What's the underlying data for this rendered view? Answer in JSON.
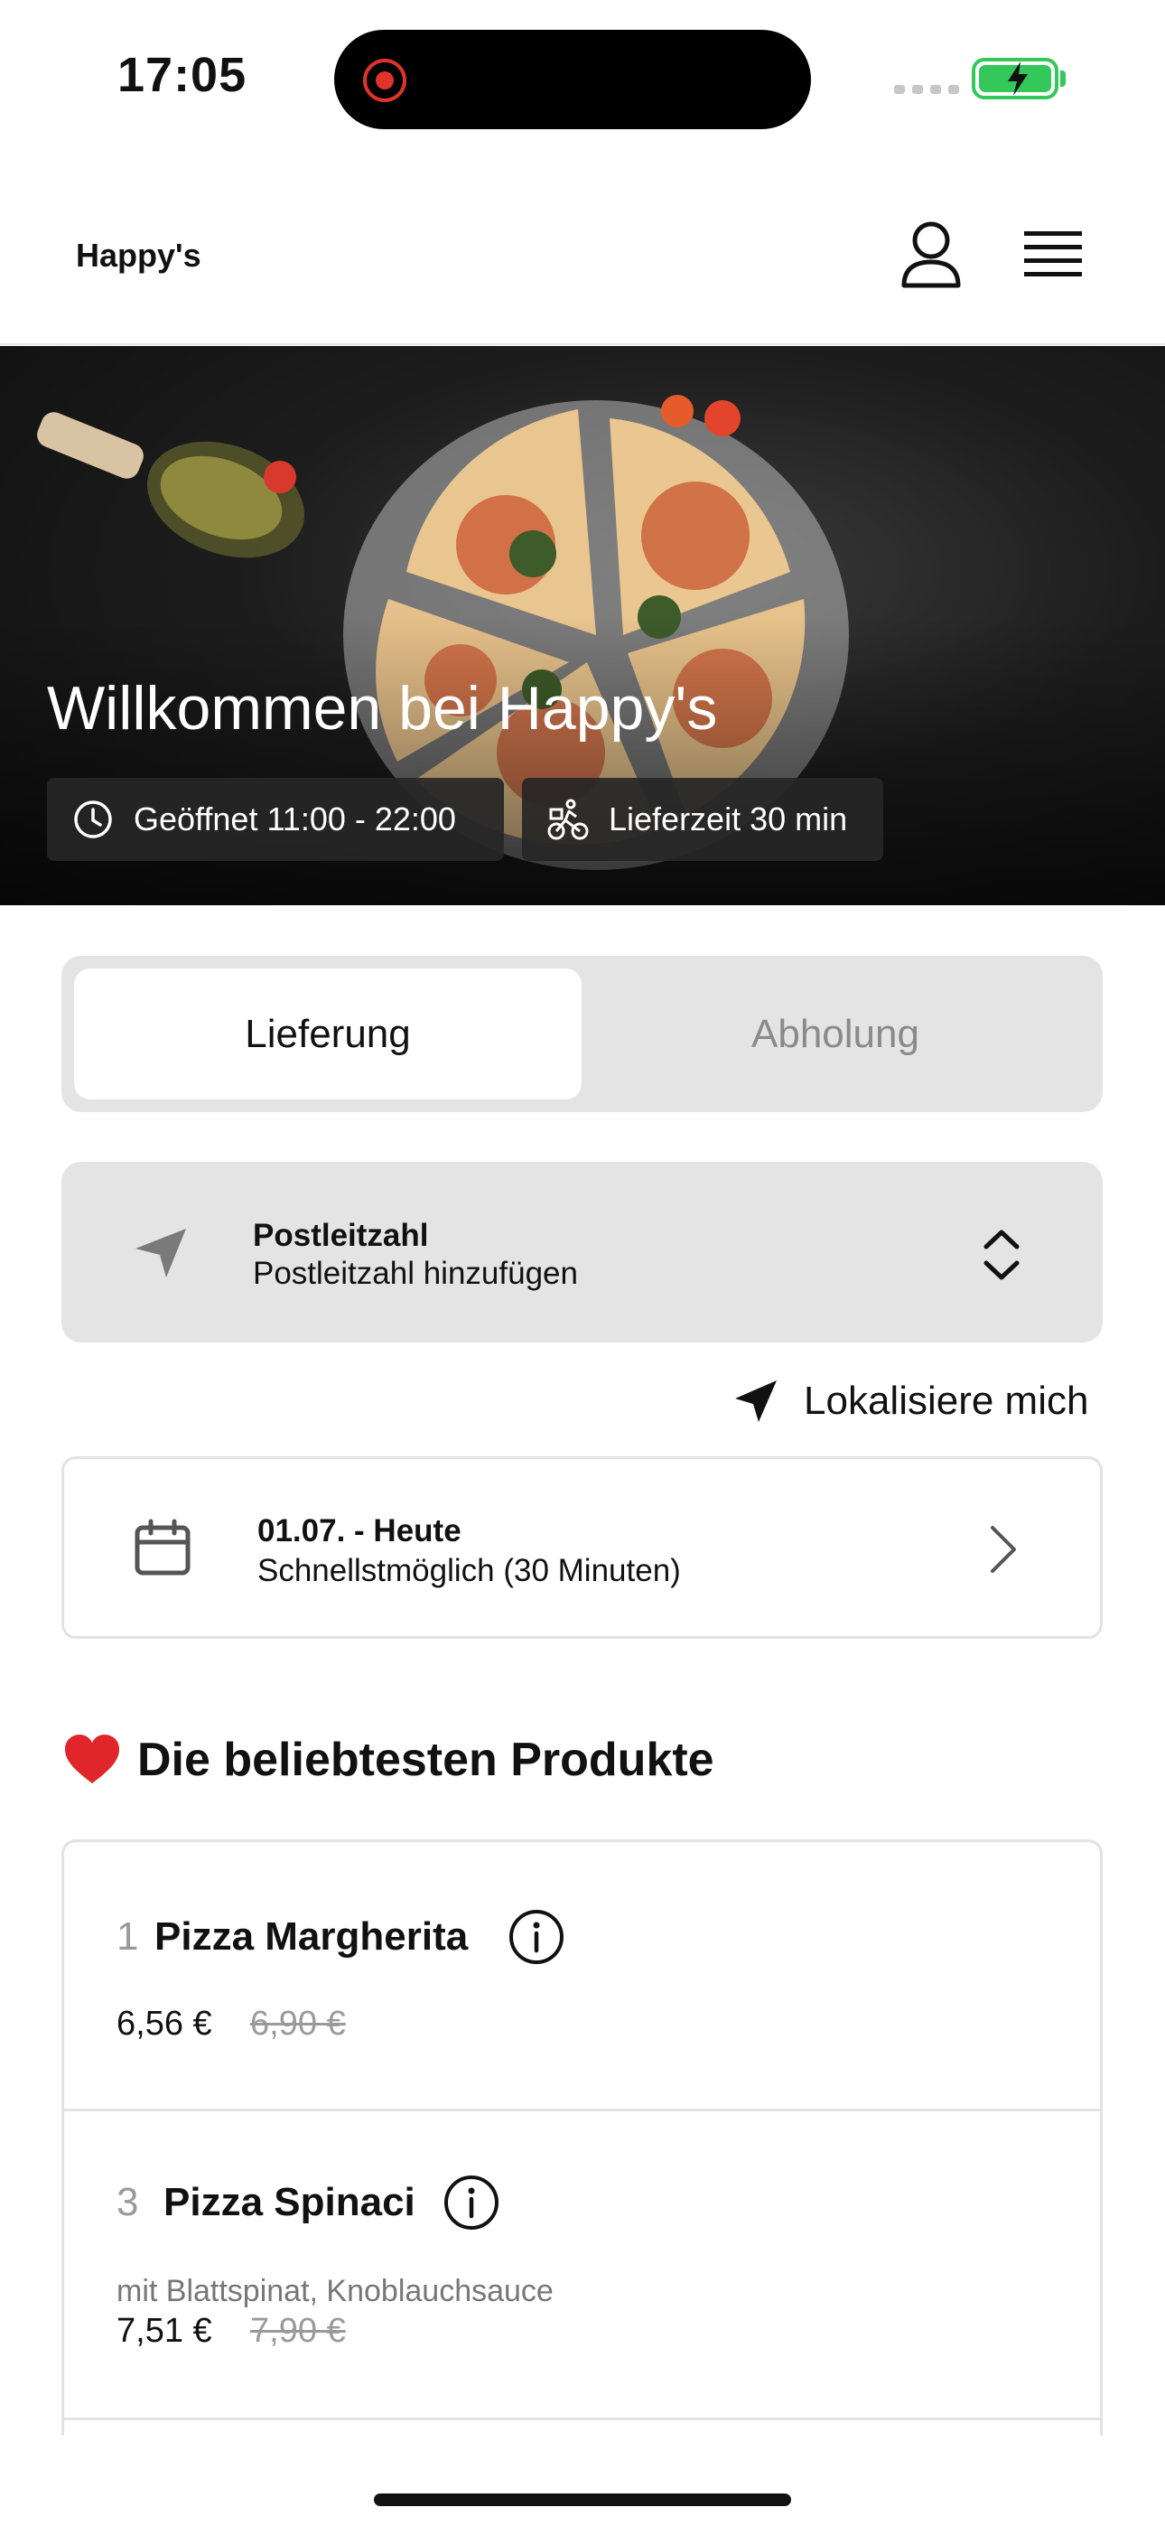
{
  "status_bar": {
    "time": "17:05"
  },
  "header": {
    "brand": "Happy's"
  },
  "hero": {
    "title": "Willkommen bei Happy's",
    "opening_hours": "Geöffnet 11:00 - 22:00",
    "delivery_time": "Lieferzeit 30 min"
  },
  "order_mode": {
    "options": [
      "Lieferung",
      "Abholung"
    ],
    "selected": "Lieferung"
  },
  "postal": {
    "title": "Postleitzahl",
    "placeholder": "Postleitzahl hinzufügen"
  },
  "locate": {
    "label": "Lokalisiere mich"
  },
  "schedule": {
    "date": "01.07. - Heute",
    "time": "Schnellstmöglich (30 Minuten)"
  },
  "popular": {
    "heading": "Die beliebtesten Produkte",
    "products": [
      {
        "rank": "1",
        "name": "Pizza Margherita",
        "description": "",
        "price": "6,56 €",
        "old_price": "6,90 €"
      },
      {
        "rank": "3",
        "name": "Pizza Spinaci",
        "description": "mit Blattspinat, Knoblauchsauce",
        "price": "7,51 €",
        "old_price": "7,90 €"
      }
    ]
  },
  "colors": {
    "accent": "#111111",
    "muted": "#8a8a8a",
    "panel": "#e4e4e4",
    "battery": "#34c759",
    "heart": "#e0262b"
  }
}
